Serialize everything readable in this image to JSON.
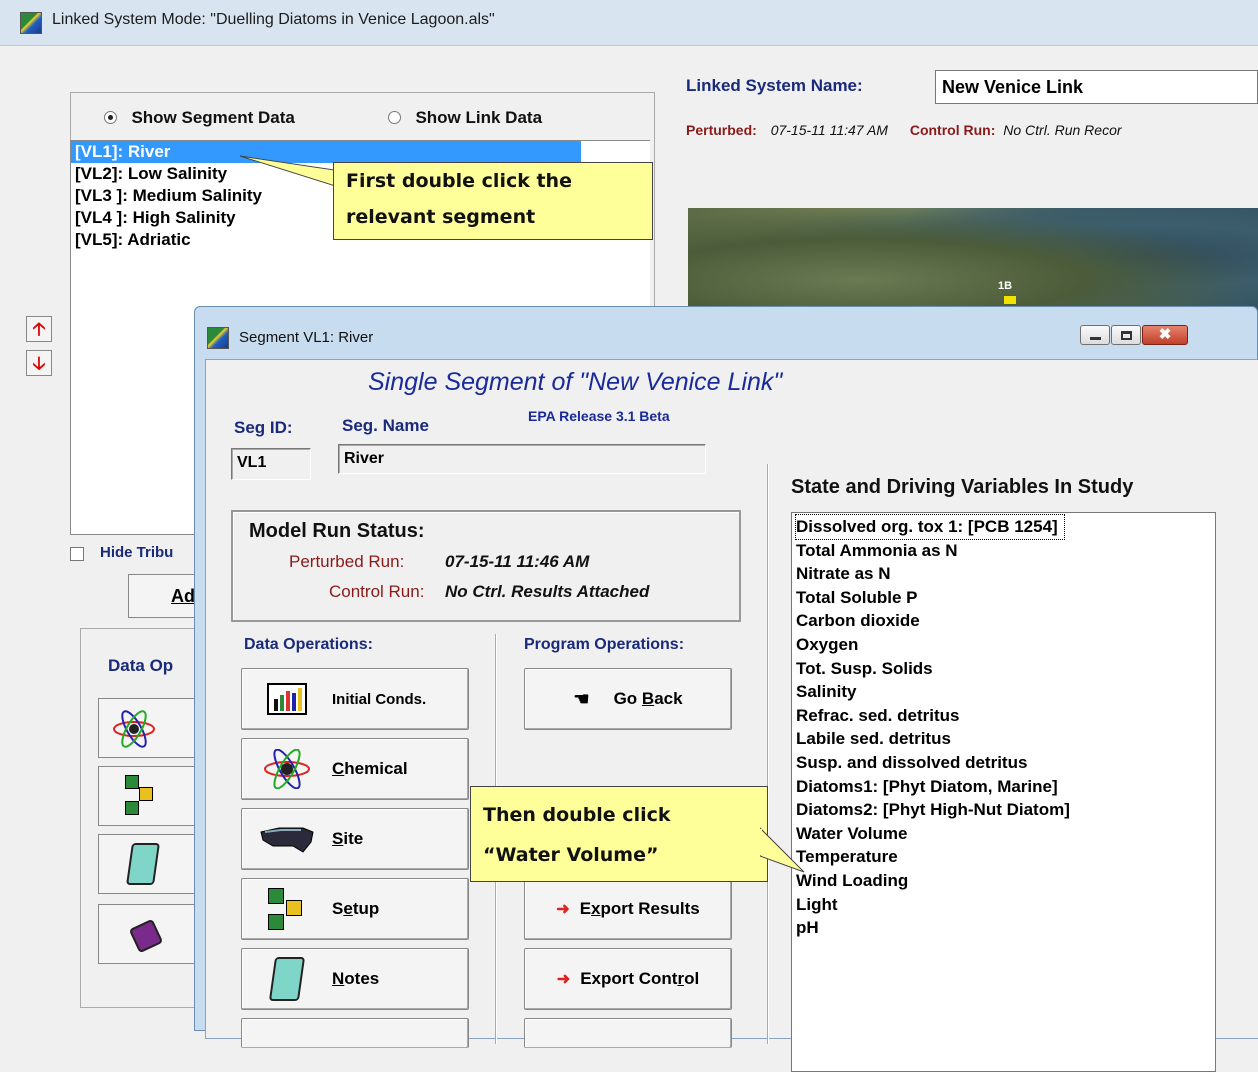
{
  "main_window": {
    "title": "Linked System Mode: \"Duelling Diatoms in Venice Lagoon.als\"",
    "show_segment_label": "Show Segment Data",
    "show_link_label": "Show Link Data",
    "segments": [
      "[VL1]: River",
      "[VL2]: Low Salinity",
      "[VL3 ]: Medium Salinity",
      "[VL4 ]: High Salinity",
      "[VL5]: Adriatic"
    ],
    "linked_system_name_label": "Linked System Name:",
    "linked_system_name": "New Venice Link",
    "perturbed_label": "Perturbed:",
    "perturbed_value": "07-15-11 11:47 AM",
    "control_run_label": "Control Run:",
    "control_run_value": "No Ctrl. Run Recor",
    "hide_tribs_label": "Hide Tribu",
    "add_button_partial": "Ad",
    "data_ops_partial": "Data Op",
    "map_marker": "1B"
  },
  "callouts": {
    "first_line1": "First double click the",
    "first_line2": "relevant segment",
    "then_line1": "Then double click",
    "then_line2": "“Water Volume”"
  },
  "segment_window": {
    "title": "Segment VL1: River",
    "heading": "Single Segment of \"New Venice Link\"",
    "release": "EPA Release 3.1 Beta",
    "seg_id_label": "Seg ID:",
    "seg_id_value": "VL1",
    "seg_name_label": "Seg. Name",
    "seg_name_value": "River",
    "status_heading": "Model Run Status:",
    "perturbed_run_label": "Perturbed Run:",
    "perturbed_run_value": "07-15-11 11:46 AM",
    "control_run_label": "Control Run:",
    "control_run_value": "No Ctrl. Results Attached",
    "data_ops_heading": "Data Operations:",
    "program_ops_heading": "Program Operations:",
    "buttons": {
      "initial_conds": "Initial Conds.",
      "chemical_pre": "",
      "chemical_u": "C",
      "chemical_post": "hemical",
      "site_u": "S",
      "site_post": "ite",
      "setup_pre": "S",
      "setup_u": "e",
      "setup_post": "tup",
      "notes_u": "N",
      "notes_post": "otes",
      "go_back_pre": "Go ",
      "go_back_u": "B",
      "go_back_post": "ack",
      "export_results_pre": "E",
      "export_results_u": "x",
      "export_results_post": "port Results",
      "export_control_pre": "Export Cont",
      "export_control_u": "r",
      "export_control_post": "ol"
    },
    "vars_heading": "State and Driving Variables In Study",
    "variables": [
      "Dissolved org. tox 1: [PCB 1254]",
      "Total Ammonia as N",
      "Nitrate as N",
      "Total Soluble P",
      "Carbon dioxide",
      "Oxygen",
      "Tot. Susp. Solids",
      "Salinity",
      "Refrac. sed. detritus",
      "Labile sed. detritus",
      "Susp. and dissolved detritus",
      "Diatoms1: [Phyt Diatom, Marine]",
      "Diatoms2: [Phyt High-Nut Diatom]",
      "Water Volume",
      "Temperature",
      "Wind Loading",
      "Light",
      "pH"
    ]
  }
}
